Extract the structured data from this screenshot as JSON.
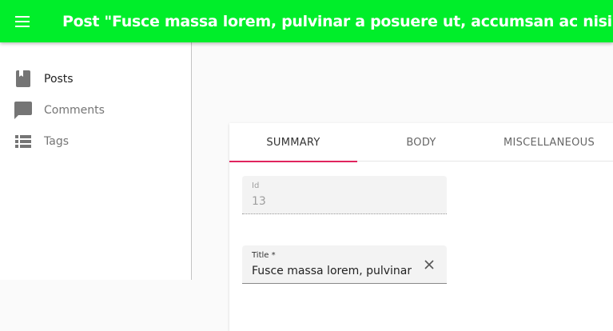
{
  "appbar": {
    "title": "Post \"Fusce massa lorem, pulvinar a posuere ut, accumsan ac nisi\"",
    "menu_icon": "menu-icon",
    "color": "#00ee2a"
  },
  "sidebar": {
    "items": [
      {
        "label": "Posts",
        "icon": "book-icon",
        "active": true
      },
      {
        "label": "Comments",
        "icon": "comment-icon",
        "active": false
      },
      {
        "label": "Tags",
        "icon": "list-icon",
        "active": false
      }
    ]
  },
  "tabs": [
    {
      "label": "SUMMARY",
      "active": true
    },
    {
      "label": "BODY",
      "active": false
    },
    {
      "label": "MISCELLANEOUS",
      "active": false
    }
  ],
  "form": {
    "id_field": {
      "label": "Id",
      "value": "13"
    },
    "title_field": {
      "label": "Title *",
      "value": "Fusce massa lorem, pulvinar a posuere ut, accumsan ac nisi"
    }
  },
  "colors": {
    "accent": "#e0245e"
  }
}
